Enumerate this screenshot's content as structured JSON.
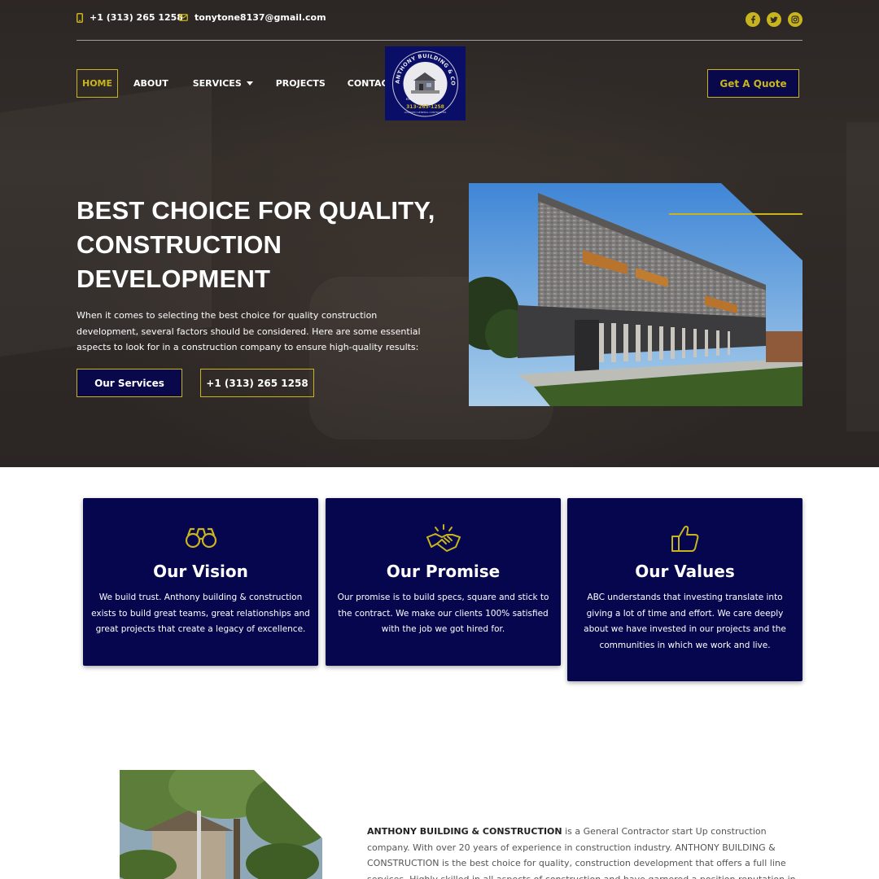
{
  "topbar": {
    "phone": "+1 (313) 265 1258",
    "email": "tonytone8137@gmail.com",
    "socials": [
      "facebook-icon",
      "twitter-icon",
      "instagram-icon"
    ]
  },
  "nav": {
    "items": [
      "HOME",
      "ABOUT",
      "SERVICES",
      "PROJECTS",
      "CONTACT"
    ],
    "active": "HOME",
    "quote_button": "Get A Quote"
  },
  "logo": {
    "ring_text": "ANTHONY BUILDING & CONSTRUCTION",
    "phone": "313-265-1258",
    "est": "EST",
    "tag": "LICENSED GENERAL CONTRACTOR"
  },
  "hero": {
    "title_lines": [
      "BEST CHOICE FOR QUALITY,",
      "CONSTRUCTION",
      "DEVELOPMENT"
    ],
    "description": "When it comes to selecting the best choice for quality construction development, several factors should be considered. Here are some essential aspects to look for in a construction company to ensure high-quality results:",
    "primary_button": "Our Services",
    "phone_button": "+1 (313) 265 1258"
  },
  "cards": [
    {
      "icon": "binoculars-icon",
      "title": "Our Vision",
      "text": "We build trust. Anthony building & construction exists to build great teams, great relationships and great projects that create a legacy of excellence."
    },
    {
      "icon": "handshake-icon",
      "title": "Our Promise",
      "text": "Our promise is to build specs, square and stick to the contract. We make our clients 100% satisfied with the job we got hired for."
    },
    {
      "icon": "thumbs-up-icon",
      "title": "Our Values",
      "text": "ABC understands that investing translate into giving a lot of time and effort. We care deeply about we have invested in our projects and the communities in which we work and live."
    }
  ],
  "about": {
    "company": "ANTHONY BUILDING & CONSTRUCTION",
    "text": "is a General Contractor start Up construction company. With over 20 years of experience in construction industry. ANTHONY BUILDING & CONSTRUCTION is the best choice for quality, construction development that offers a full line services. Highly skilled in all aspects of construction and have garnered a position reputation in the local construction community for ethical"
  },
  "colors": {
    "accent": "#c8b51e",
    "navy": "#06064f",
    "hero_bg": "#2e2826"
  }
}
